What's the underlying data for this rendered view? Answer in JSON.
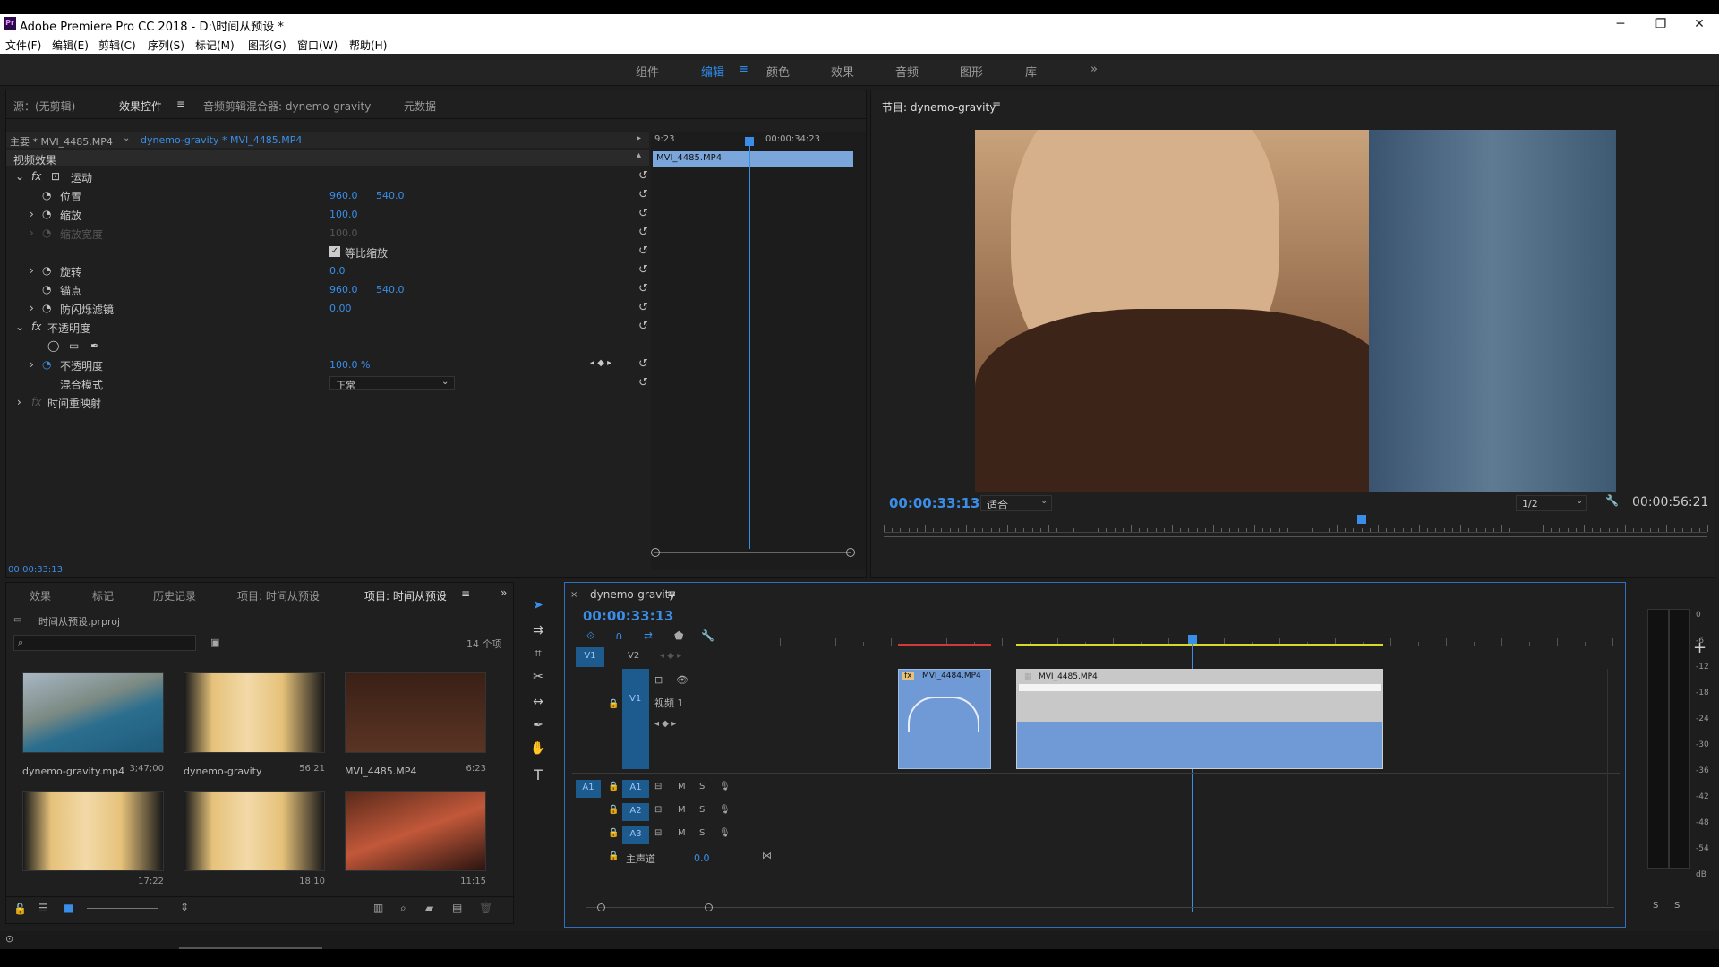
{
  "app": {
    "title": "Adobe Premiere Pro CC 2018 - D:\\时间从预设 *",
    "logo": "Pr"
  },
  "menu": [
    "文件(F)",
    "编辑(E)",
    "剪辑(C)",
    "序列(S)",
    "标记(M)",
    "图形(G)",
    "窗口(W)",
    "帮助(H)"
  ],
  "workspaces": {
    "items": [
      "组件",
      "编辑",
      "颜色",
      "效果",
      "音频",
      "图形",
      "库"
    ],
    "active": "编辑",
    "more": "»"
  },
  "source_panel": {
    "tabs": [
      "源：(无剪辑)",
      "效果控件",
      "音频剪辑混合器: dynemo-gravity",
      "元数据"
    ],
    "master": "主要 * MVI_4485.MP4",
    "sequence_clip": "dynemo-gravity * MVI_4485.MP4",
    "ruler_start": "9:23",
    "ruler_end": "00:00:34:23",
    "clip_name": "MVI_4485.MP4",
    "section": "视频效果",
    "rows": [
      {
        "name": "运动",
        "fx": true
      },
      {
        "name": "位置",
        "v1": "960.0",
        "v2": "540.0"
      },
      {
        "name": "缩放",
        "v1": "100.0"
      },
      {
        "name": "缩放宽度",
        "v1": "100.0",
        "disabled": true
      },
      {
        "name": "等比缩放",
        "checkbox": true
      },
      {
        "name": "旋转",
        "v1": "0.0"
      },
      {
        "name": "锚点",
        "v1": "960.0",
        "v2": "540.0"
      },
      {
        "name": "防闪烁滤镜",
        "v1": "0.00"
      },
      {
        "name": "不透明度",
        "fx": true
      },
      {
        "name": "不透明度",
        "v1": "100.0 %"
      },
      {
        "name": "混合模式",
        "select": "正常"
      },
      {
        "name": "时间重映射",
        "fx": true
      }
    ],
    "timecode": "00:00:33:13"
  },
  "program_monitor": {
    "title": "节目: dynemo-gravity",
    "timecode": "00:00:33:13",
    "fit": "适合",
    "quality": "1/2",
    "duration": "00:00:56:21",
    "playhead_pct": 0.58
  },
  "project_panel": {
    "tabs": [
      "效果",
      "标记",
      "历史记录",
      "项目: 时间从预设",
      "项目: 时间从预设"
    ],
    "project_file": "时间从预设.prproj",
    "count": "14 个项",
    "items": [
      {
        "name": "dynemo-gravity.mp4",
        "dur": "3;47;00"
      },
      {
        "name": "dynemo-gravity",
        "dur": "56:21"
      },
      {
        "name": "MVI_4485.MP4",
        "dur": "6:23"
      },
      {
        "name": "",
        "dur": "17:22"
      },
      {
        "name": "",
        "dur": "18:10"
      },
      {
        "name": "",
        "dur": "11:15"
      }
    ]
  },
  "timeline": {
    "sequence": "dynemo-gravity",
    "timecode": "00:00:33:13",
    "video_tracks": [
      "V2",
      "V1"
    ],
    "track_name": "视频 1",
    "audio_tracks": [
      "A1",
      "A2",
      "A3"
    ],
    "master": "主声道",
    "master_val": "0.0",
    "clips": [
      {
        "name": "MVI_4484.MP4"
      },
      {
        "name": "MVI_4485.MP4"
      }
    ]
  },
  "meter": {
    "ticks": [
      "0",
      "-6",
      "-12",
      "-18",
      "-24",
      "-30",
      "-36",
      "-42",
      "-48",
      "-54",
      "dB"
    ],
    "solo": [
      "S",
      "S"
    ]
  },
  "colors": {
    "accent": "#2d8ceb",
    "clip": "#6f9ad6"
  }
}
